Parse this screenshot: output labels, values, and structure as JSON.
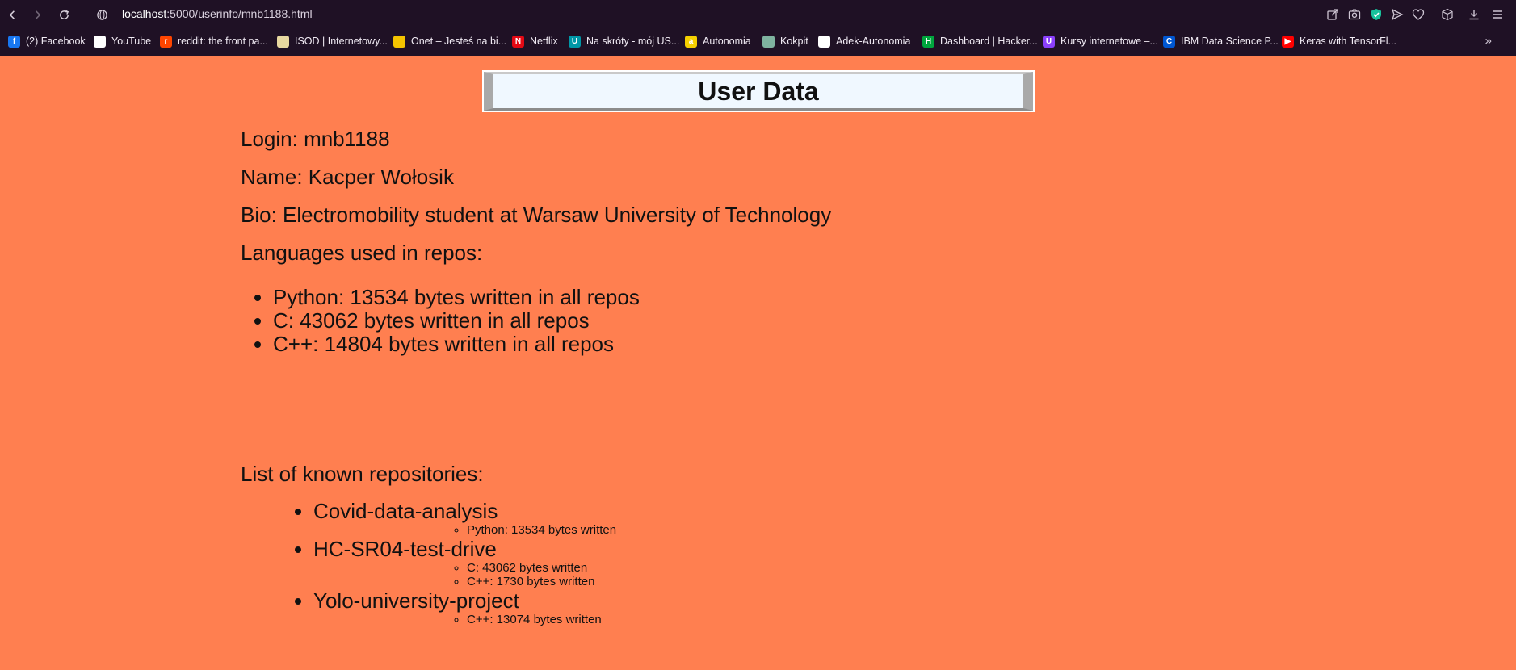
{
  "browser": {
    "url_host": "localhost",
    "url_path": ":5000/userinfo/mnb1188.html",
    "bookmarks": [
      {
        "label": "(2) Facebook",
        "color": "#1877f2",
        "glyph": "f"
      },
      {
        "label": "YouTube",
        "color": "#ffffff",
        "glyph": ""
      },
      {
        "label": "reddit: the front pa...",
        "color": "#ff4500",
        "glyph": "r"
      },
      {
        "label": "ISOD | Internetowy...",
        "color": "#e8d8a0",
        "glyph": ""
      },
      {
        "label": "Onet – Jesteś na bi...",
        "color": "#f5c400",
        "glyph": ""
      },
      {
        "label": "Netflix",
        "color": "#e50914",
        "glyph": "N"
      },
      {
        "label": "Na skróty - mój US...",
        "color": "#0097a7",
        "glyph": "U"
      },
      {
        "label": "Autonomia",
        "color": "#f5d000",
        "glyph": "a"
      },
      {
        "label": "Kokpit",
        "color": "#7fb3a0",
        "glyph": ""
      },
      {
        "label": "Adek-Autonomia",
        "color": "#ffffff",
        "glyph": ""
      },
      {
        "label": "Dashboard | Hacker...",
        "color": "#00a63e",
        "glyph": "H"
      },
      {
        "label": "Kursy internetowe –...",
        "color": "#8a3ffc",
        "glyph": "U"
      },
      {
        "label": "IBM Data Science P...",
        "color": "#0056d2",
        "glyph": "C"
      },
      {
        "label": "Keras with TensorFl...",
        "color": "#ff0000",
        "glyph": "▶"
      }
    ]
  },
  "page": {
    "title": "User Data",
    "login": "Login: mnb1188",
    "name": "Name: Kacper Wołosik",
    "bio": "Bio: Electromobility student at Warsaw University of Technology",
    "languages_heading": "Languages used in repos:",
    "languages": [
      "Python: 13534 bytes written in all repos",
      "C: 43062 bytes written in all repos",
      "C++: 14804 bytes written in all repos"
    ],
    "repos_heading": "List of known repositories:",
    "repos": [
      {
        "name": "Covid-data-analysis",
        "langs": [
          "Python: 13534 bytes written"
        ]
      },
      {
        "name": "HC-SR04-test-drive",
        "langs": [
          "C: 43062 bytes written",
          "C++: 1730 bytes written"
        ]
      },
      {
        "name": "Yolo-university-project",
        "langs": [
          "C++: 13074 bytes written"
        ]
      }
    ]
  },
  "colors": {
    "page_background": "#ff7f50",
    "title_box": "#f0f8ff",
    "chrome": "#1f1125"
  }
}
